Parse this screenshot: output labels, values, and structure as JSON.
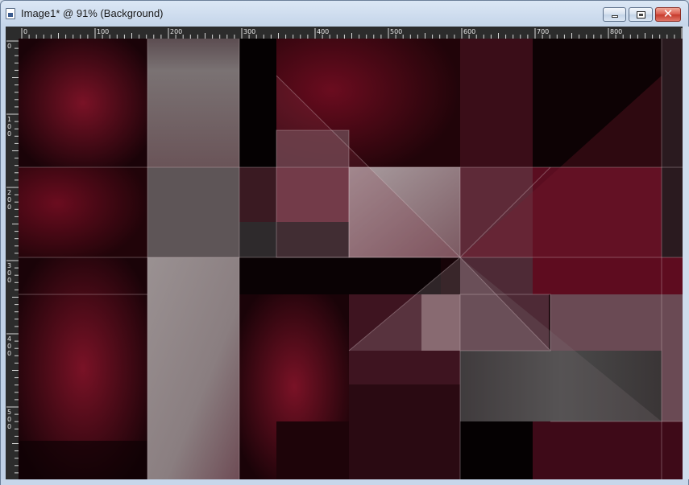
{
  "window": {
    "title": "Image1* @  91% (Background)"
  },
  "controls": {
    "minimize_icon": "minimize-icon",
    "maximize_icon": "restore-icon",
    "close_icon": "close-icon",
    "close_glyph": "✕"
  },
  "ruler": {
    "horizontal_labels": [
      "0",
      "100",
      "200",
      "300",
      "400",
      "500",
      "600",
      "700",
      "800"
    ],
    "vertical_labels": [
      "0",
      "100",
      "200",
      "300",
      "400",
      "500"
    ]
  },
  "colors": {
    "canvas_base": "#170408",
    "crimson": "#6a0b1e",
    "grey": "#8a8384",
    "dark": "#0a0204"
  }
}
